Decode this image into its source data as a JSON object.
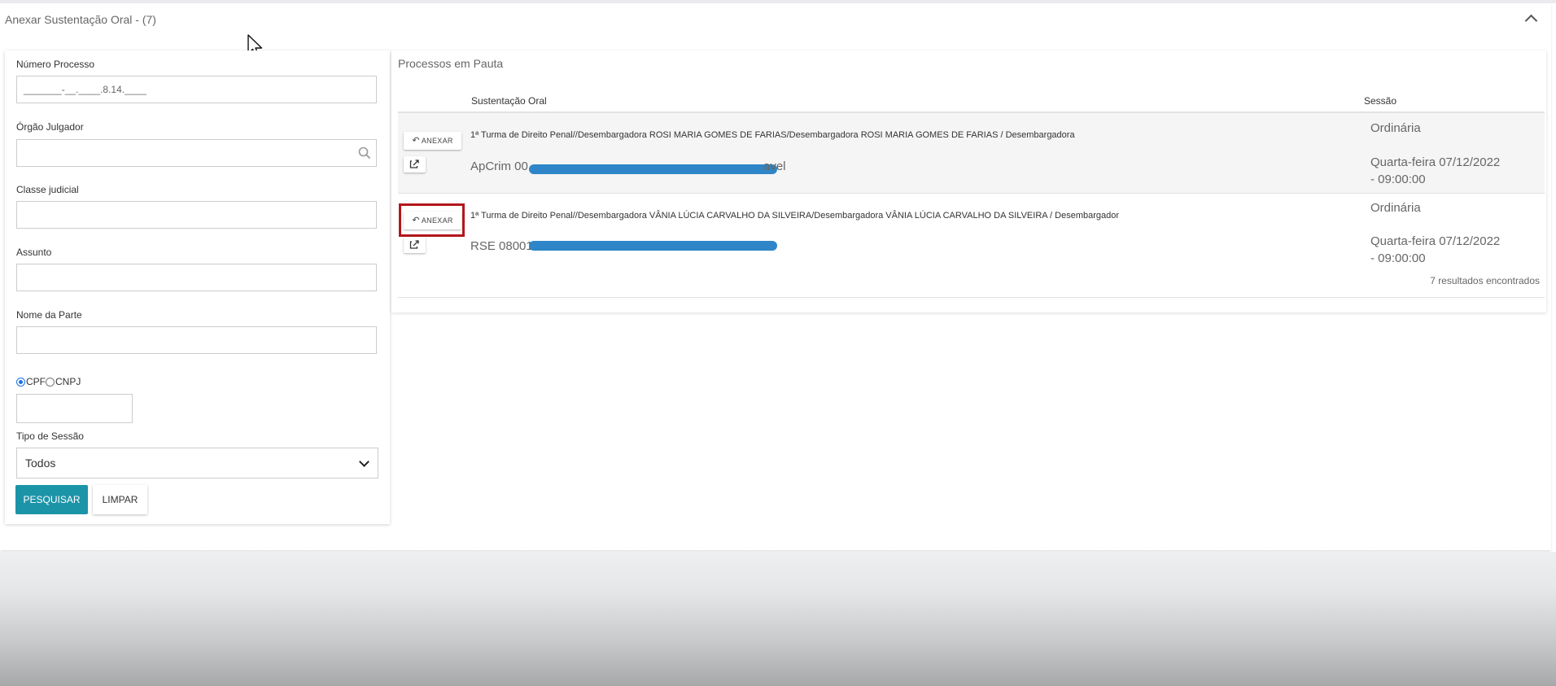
{
  "panel": {
    "title": "Anexar Sustentação Oral - (7)"
  },
  "filters": {
    "numero_processo": {
      "label": "Número Processo",
      "value": "_______-__.____.8.14.____"
    },
    "orgao_julgador": {
      "label": "Órgão Julgador",
      "value": ""
    },
    "classe_judicial": {
      "label": "Classe judicial",
      "value": ""
    },
    "assunto": {
      "label": "Assunto",
      "value": ""
    },
    "nome_parte": {
      "label": "Nome da Parte",
      "value": ""
    },
    "documento": {
      "options": [
        "CPF",
        "CNPJ"
      ],
      "selected": "CPF",
      "value": ""
    },
    "tipo_sessao": {
      "label": "Tipo de Sessão",
      "selected": "Todos"
    },
    "buttons": {
      "search": "PESQUISAR",
      "clear": "LIMPAR"
    }
  },
  "results": {
    "title": "Processos em Pauta",
    "columns": {
      "sustentacao": "Sustentação Oral",
      "sessao": "Sessão"
    },
    "rows": [
      {
        "action_label": "ANEXAR",
        "description": "1ª Turma de Direito Penal//Desembargadora ROSI MARIA GOMES DE FARIAS/Desembargadora ROSI MARIA GOMES DE FARIAS / Desembargadora",
        "process_prefix": "ApCrim 00",
        "process_suffix": "avel",
        "session_type": "Ordinária",
        "session_date": "Quarta-feira 07/12/2022",
        "session_time": "- 09:00:00"
      },
      {
        "action_label": "ANEXAR",
        "description": "1ª Turma de Direito Penal//Desembargadora VÂNIA LÚCIA CARVALHO DA SILVEIRA/Desembargadora VÂNIA LÚCIA CARVALHO DA SILVEIRA / Desembargador",
        "process_prefix": "RSE 08001",
        "process_suffix": "",
        "session_type": "Ordinária",
        "session_date": "Quarta-feira 07/12/2022",
        "session_time": "- 09:00:00"
      }
    ],
    "count_text": "7 resultados encontrados"
  },
  "icons": [
    "chevron-up-icon",
    "mouse-cursor-icon",
    "search-icon",
    "reply-icon",
    "external-link-icon",
    "chevron-down-icon"
  ],
  "colors": {
    "primary_button": "#1c94a8",
    "highlight": "#b3161b",
    "redaction": "#2e86c8"
  }
}
